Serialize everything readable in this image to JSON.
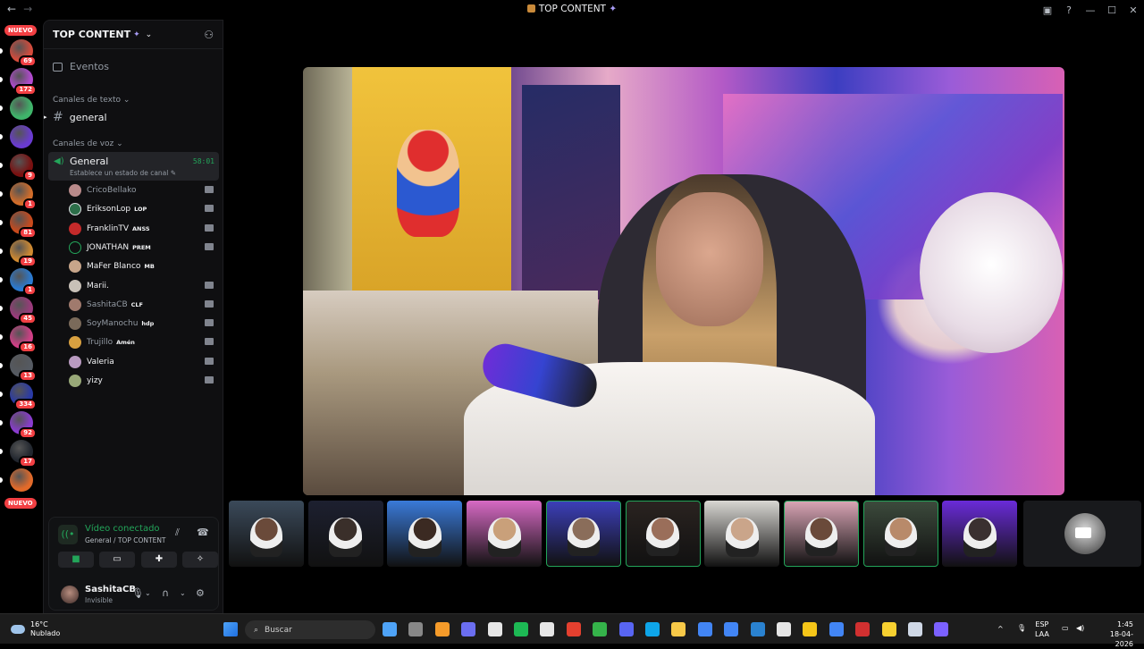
{
  "window": {
    "title": "TOP CONTENT",
    "back": "←",
    "forward": "→",
    "controls": [
      "▣",
      "?",
      "—",
      "☐",
      "✕"
    ]
  },
  "guilds": {
    "new_badge_top": "NUEVO",
    "new_badge_bottom": "NUEVO",
    "items": [
      {
        "badge": "69",
        "color": "#d44b3c"
      },
      {
        "badge": "172",
        "color": "#b24ad0"
      },
      {
        "badge": "",
        "color": "#3fb56a"
      },
      {
        "badge": "",
        "color": "#6a3bd1"
      },
      {
        "badge": "9",
        "color": "#7a1010"
      },
      {
        "badge": "1",
        "color": "#d26d2a"
      },
      {
        "badge": "81",
        "color": "#c94a1c"
      },
      {
        "badge": "19",
        "color": "#d08a31"
      },
      {
        "badge": "1",
        "color": "#2a7ad1"
      },
      {
        "badge": "45",
        "color": "#9b3a7c"
      },
      {
        "badge": "16",
        "color": "#d13f87"
      },
      {
        "badge": "13",
        "color": "#555a62"
      },
      {
        "badge": "334",
        "color": "#2a3aa6"
      },
      {
        "badge": "92",
        "color": "#8a3bd0"
      },
      {
        "badge": "17",
        "color": "#21262e"
      },
      {
        "badge": "",
        "color": "#e26a2a"
      }
    ]
  },
  "sidebar": {
    "server_name": "TOP CONTENT",
    "events_label": "Eventos",
    "text_category": "Canales de texto",
    "text_channel": "general",
    "voice_category": "Canales de voz",
    "voice_channel": {
      "name": "General",
      "status": "Establece un estado de canal",
      "timer": "58:01"
    },
    "members": [
      {
        "name": "CricoBellako",
        "tag": "",
        "active": false,
        "color": "#b98a8a"
      },
      {
        "name": "EriksonLop",
        "tag": "LOP",
        "active": true,
        "color": "#2c6e49"
      },
      {
        "name": "FranklinTV",
        "tag": "ANSS",
        "active": true,
        "color": "#c42a2a"
      },
      {
        "name": "JONATHAN",
        "tag": "PREM",
        "active": true,
        "color": "#0f0f11"
      },
      {
        "name": "MaFer Blanco",
        "tag": "MB",
        "active": true,
        "color": "#c7a58a"
      },
      {
        "name": "Marii.",
        "tag": "",
        "active": true,
        "color": "#c8c1b8"
      },
      {
        "name": "SashitaCB",
        "tag": "CLF",
        "active": false,
        "color": "#a07a6d"
      },
      {
        "name": "SoyManochu",
        "tag": "hdp",
        "active": false,
        "color": "#7a6a5a"
      },
      {
        "name": "Trujillo",
        "tag": "Amén",
        "active": false,
        "color": "#d8a040"
      },
      {
        "name": "Valeria",
        "tag": "",
        "active": true,
        "color": "#b89ac0"
      },
      {
        "name": "yizy",
        "tag": "",
        "active": true,
        "color": "#98a878"
      }
    ]
  },
  "voice_panel": {
    "connected": "Vídeo conectado",
    "location": "General / TOP CONTENT",
    "user_name": "SashitaCB",
    "user_status": "Invisible"
  },
  "thumbnails": [
    {
      "bg": "#3b4a5a",
      "person": "#6a4a3a",
      "speaking": false
    },
    {
      "bg": "#1d2030",
      "person": "#3a2f2a",
      "speaking": false
    },
    {
      "bg": "#3a7ad8",
      "person": "#3b2a22",
      "speaking": false
    },
    {
      "bg": "#d76ac4",
      "person": "#c9a07a",
      "speaking": false
    },
    {
      "bg": "#3c3fb8",
      "person": "#8a6d5a",
      "speaking": true
    },
    {
      "bg": "#2a2320",
      "person": "#9a6e5a",
      "speaking": true
    },
    {
      "bg": "#d8d6d2",
      "person": "#caa58a",
      "speaking": false
    },
    {
      "bg": "#d8a4b4",
      "person": "#6a4a3a",
      "speaking": true
    },
    {
      "bg": "#3c4a3c",
      "person": "#b88a6a",
      "speaking": true
    },
    {
      "bg": "#6a2bd8",
      "person": "#3a3030",
      "speaking": false
    }
  ],
  "taskbar": {
    "temp": "16°C",
    "weather": "Nublado",
    "search_placeholder": "Buscar",
    "language": "ESP",
    "layout": "LAA",
    "time": "1:45",
    "date": "18-04-2026",
    "apps": [
      "#4ea3f7",
      "#888888",
      "#f59b2a",
      "#6b6ef0",
      "#e6e6e6",
      "#1db954",
      "#e6e6e6",
      "#e4402f",
      "#35b34a",
      "#5865f2",
      "#0ea5e9",
      "#f7c948",
      "#4285f4",
      "#4285f4",
      "#2a82d0",
      "#e6e6e6",
      "#f5c518",
      "#4285f4",
      "#d13030",
      "#f7d030",
      "#cfd8e6",
      "#7b61ff"
    ]
  }
}
